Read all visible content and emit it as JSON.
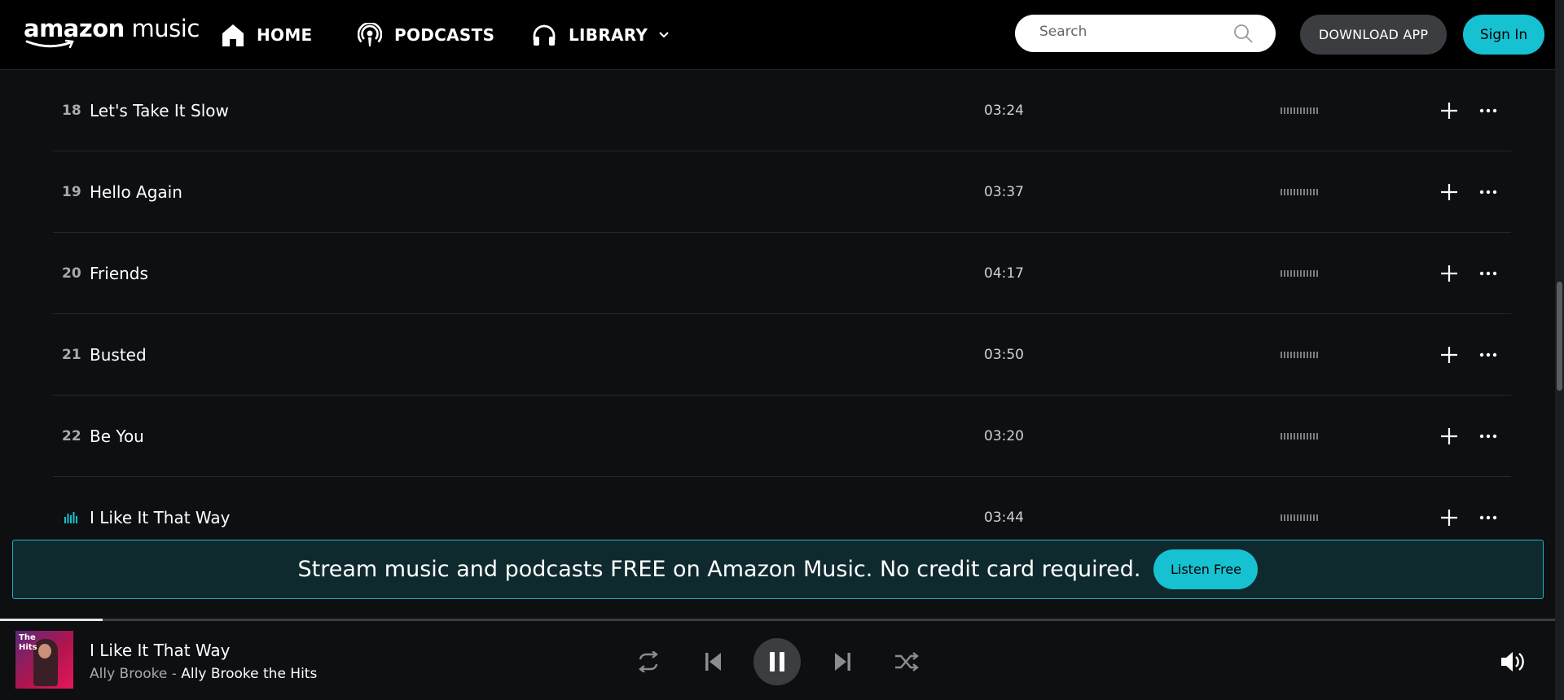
{
  "header": {
    "logo": {
      "bold": "amazon",
      "light": "music"
    },
    "nav": {
      "home": "HOME",
      "podcasts": "PODCASTS",
      "library": "LIBRARY"
    },
    "search": {
      "placeholder": "Search",
      "value": ""
    },
    "download_label": "DOWNLOAD APP",
    "signin_label": "Sign In"
  },
  "tracks": [
    {
      "num": "18",
      "title": "Let's Take It Slow",
      "duration": "03:24"
    },
    {
      "num": "19",
      "title": "Hello Again",
      "duration": "03:37"
    },
    {
      "num": "20",
      "title": "Friends",
      "duration": "04:17"
    },
    {
      "num": "21",
      "title": "Busted",
      "duration": "03:50"
    },
    {
      "num": "22",
      "title": "Be You",
      "duration": "03:20"
    },
    {
      "num": "",
      "title": "I Like It That Way",
      "duration": "03:44",
      "playing": true
    }
  ],
  "promo": {
    "text": "Stream music and podcasts FREE on Amazon Music. No credit card required.",
    "button": "Listen Free"
  },
  "player": {
    "art_label": "The\nHits",
    "title": "I Like It That Way",
    "artist": "Ally Brooke",
    "separator": " - ",
    "album": "Ally Brooke the Hits",
    "progress_fraction": 0.066,
    "state": "playing"
  },
  "colors": {
    "accent": "#16c1d1",
    "background": "#0d0f11",
    "header": "#000000",
    "divider": "#25282c"
  },
  "icons": [
    "home-icon",
    "podcast-icon",
    "headphones-icon",
    "chevron-down-icon",
    "search-icon",
    "plus-icon",
    "more-icon",
    "equalizer-icon",
    "repeat-icon",
    "previous-icon",
    "pause-icon",
    "next-icon",
    "shuffle-icon",
    "volume-icon"
  ]
}
